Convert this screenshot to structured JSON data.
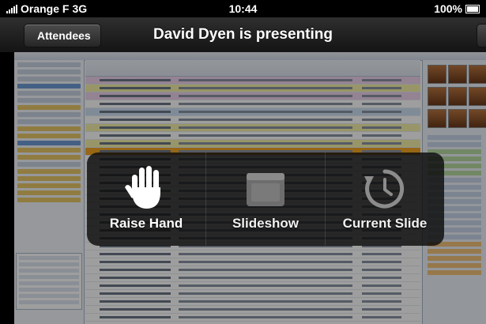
{
  "status_bar": {
    "carrier": "Orange F",
    "network": "3G",
    "time": "10:44",
    "battery": "100%"
  },
  "nav": {
    "back_label": "Attendees",
    "title": "David Dyen is presenting"
  },
  "hud": {
    "raise_hand_label": "Raise Hand",
    "slideshow_label": "Slideshow",
    "current_slide_label": "Current Slide"
  },
  "colors": {
    "highlight_orange": "#f4a623",
    "highlight_pink": "#efd3ee",
    "highlight_yellow": "#f6f3a9"
  },
  "icons": {
    "raise_hand": "hand-icon",
    "slideshow": "slideshow-icon",
    "current_slide": "clock-arrow-icon"
  }
}
